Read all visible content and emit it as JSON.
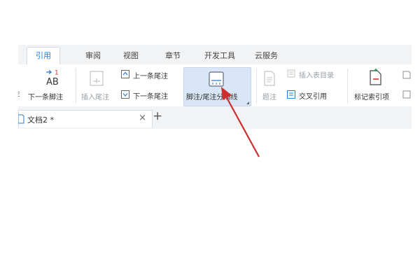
{
  "tabs": [
    "引用",
    "审阅",
    "视图",
    "章节",
    "开发工具",
    "云服务"
  ],
  "ribbon": {
    "next_footnote": "下一条脚注",
    "insert_endnote": "插入尾注",
    "prev_endnote": "上一条尾注",
    "next_endnote": "下一条尾注",
    "footnote_separator": "脚注/尾注分隔线",
    "caption": "题注",
    "insert_toc": "插入表目录",
    "cross_reference": "交叉引用",
    "mark_index": "标记索引项",
    "left_edge_char": "E"
  },
  "document_tab": {
    "label": "文档2 *",
    "close": "×",
    "add": "+"
  },
  "colors": {
    "active_tab": "#2b7bd6",
    "highlight": "#d9e6f7",
    "arrow": "#cc2d2d"
  }
}
